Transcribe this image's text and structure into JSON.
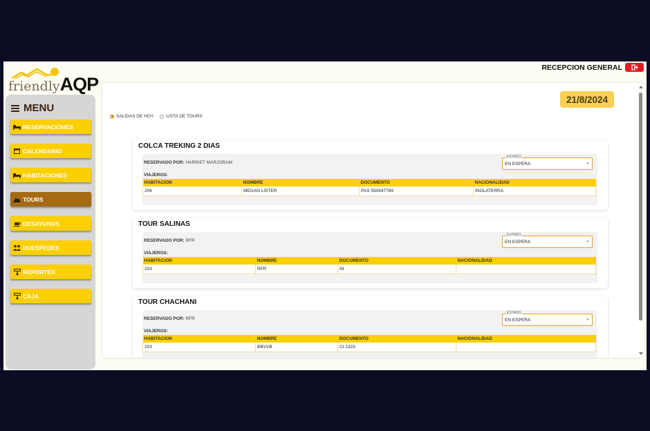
{
  "header": {
    "title": "RECEPCION GENERAL",
    "logout_icon": "logout-icon",
    "accent": "#e11b22"
  },
  "logo": {
    "part1": "friendly",
    "part2": "AQP"
  },
  "sidebar": {
    "menu_label": "MENU",
    "items": [
      {
        "label": "RESERVACIONES",
        "icon": "bed-icon",
        "active": false
      },
      {
        "label": "CALENDARIO",
        "icon": "calendar-icon",
        "active": false
      },
      {
        "label": "HABITACIONES",
        "icon": "bed-icon",
        "active": false
      },
      {
        "label": "TOURS",
        "icon": "mountain-icon",
        "active": true
      },
      {
        "label": "DESAYUNOS",
        "icon": "breakfast-icon",
        "active": false
      },
      {
        "label": "HUESPEDES",
        "icon": "users-icon",
        "active": false
      },
      {
        "label": "REPORTES",
        "icon": "report-icon",
        "active": false
      },
      {
        "label": "CAJA",
        "icon": "cash-icon",
        "active": false
      }
    ]
  },
  "main": {
    "date": "21/8/2024",
    "radio": {
      "option1": "SALIDAS DE HOY",
      "option2": "LISTA DE TOURS",
      "selected": "SALIDAS DE HOY"
    },
    "columns": [
      "HABITACION",
      "NOMBRE",
      "DOCUMENTO",
      "NACIONALIDAD"
    ],
    "reserved_label": "RESERVADO POR:",
    "travelers_label": "VIAJEROS:",
    "estado_label": "ESTADO",
    "tours": [
      {
        "name": "COLCA TREKING 2 DIAS",
        "reserved_by": "HARRIET MARJORAM",
        "estado": "EN ESPERA",
        "travelers": [
          {
            "habitacion": "206",
            "nombre": "MEGAN LISTER",
            "documento": "PAS 550947769",
            "nacionalidad": "INGLATERRA"
          }
        ]
      },
      {
        "name": "TOUR SALINAS",
        "reserved_by": "RFR",
        "estado": "EN ESPERA",
        "travelers": [
          {
            "habitacion": "203",
            "nombre": "RFR",
            "documento": "NI",
            "nacionalidad": ""
          }
        ]
      },
      {
        "name": "TOUR CHACHANI",
        "reserved_by": "RFR",
        "estado": "EN ESPERA",
        "travelers": [
          {
            "habitacion": "203",
            "nombre": "BBVVB",
            "documento": "CI 2323",
            "nacionalidad": ""
          }
        ]
      }
    ]
  }
}
